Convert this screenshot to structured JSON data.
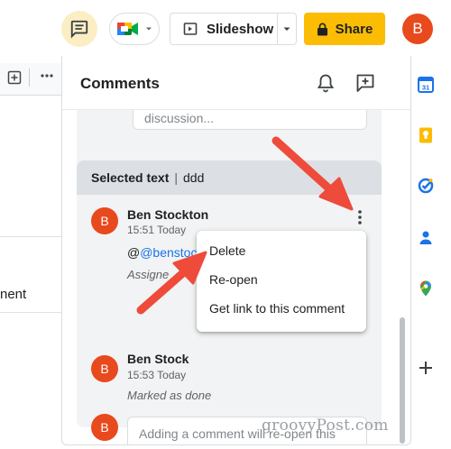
{
  "toolbar": {
    "slideshow_label": "Slideshow",
    "share_label": "Share",
    "avatar_initial": "B"
  },
  "document": {
    "partial_text": "nent"
  },
  "comments_panel": {
    "title": "Comments",
    "top_thread": {
      "input_placeholder_tail": "discussion..."
    },
    "selected_thread": {
      "header_label": "Selected text",
      "header_value": "ddd",
      "comments": [
        {
          "avatar_initial": "B",
          "author": "Ben Stockton",
          "timestamp": "15:51 Today",
          "mention": "@benstockt",
          "status": "Assigne"
        },
        {
          "avatar_initial": "B",
          "author": "Ben Stock",
          "timestamp": "15:53 Today",
          "status": "Marked as done"
        }
      ],
      "reply_avatar_initial": "B",
      "reply_placeholder": "Adding a comment will re-open this discussion..."
    }
  },
  "context_menu": {
    "items": [
      "Delete",
      "Re-open",
      "Get link to this comment"
    ]
  },
  "watermark": "groovyPost.com",
  "colors": {
    "share_yellow": "#fbbc04",
    "avatar_orange": "#e8491d",
    "arrow_red": "#ee4b3b",
    "mention_blue": "#1a73e8"
  }
}
